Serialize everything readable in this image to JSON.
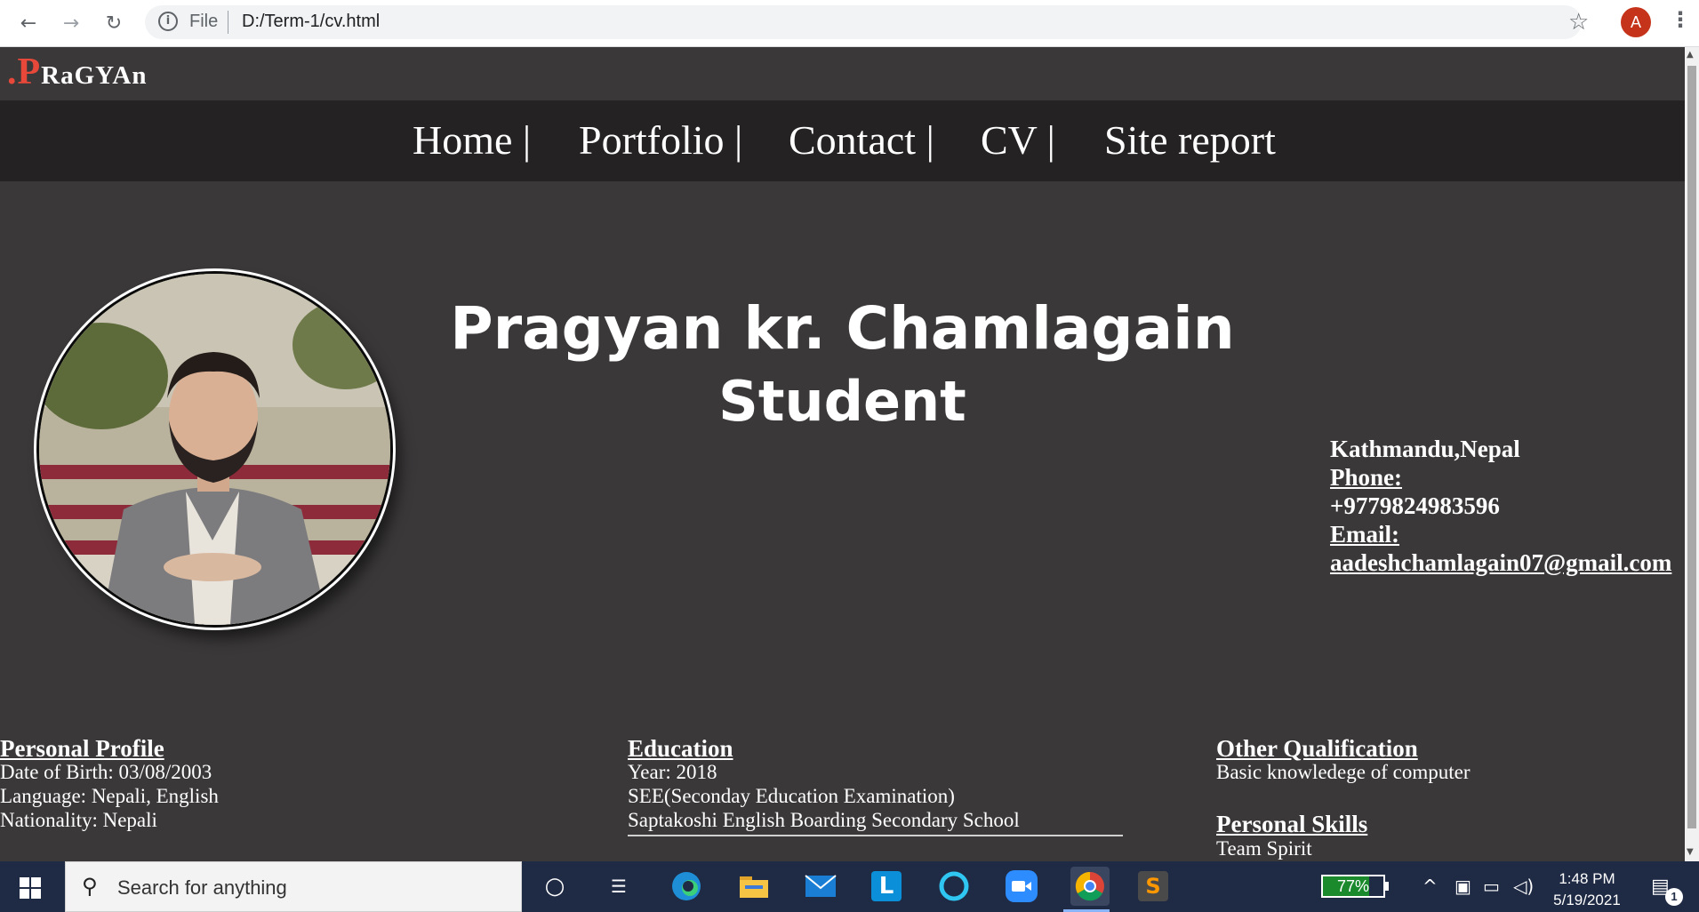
{
  "browser": {
    "url_scheme_label": "File",
    "url": "D:/Term-1/cv.html",
    "profile_initial": "A"
  },
  "site": {
    "logo": {
      "dot": ".",
      "cap": "P",
      "rest": "RaGYAn"
    },
    "nav": [
      "Home |",
      "Portfolio |",
      "Contact |",
      "CV |",
      "Site report"
    ]
  },
  "profile": {
    "name": "Pragyan kr. Chamlagain",
    "role": "Student"
  },
  "contact": {
    "address": "Kathmandu,Nepal",
    "phone_label": "Phone:",
    "phone": "+9779824983596",
    "email_label": "Email:",
    "email": "aadeshchamlagain07@gmail.com"
  },
  "sections": {
    "personal_profile": {
      "title": "Personal Profile",
      "lines": [
        "Date of Birth: 03/08/2003",
        "Language: Nepali, English",
        "Nationality: Nepali"
      ]
    },
    "education": {
      "title": "Education",
      "lines": [
        "Year: 2018",
        "SEE(Seconday Education Examination)",
        "Saptakoshi English Boarding Secondary School"
      ]
    },
    "other_qualification": {
      "title": "Other Qualification",
      "lines": [
        "Basic knowledege of computer"
      ]
    },
    "personal_skills": {
      "title": "Personal Skills",
      "lines": [
        "Team Spirit"
      ]
    }
  },
  "taskbar": {
    "search_placeholder": "Search for anything",
    "battery_percent": "77%",
    "battery_level": 0.77,
    "time": "1:48 PM",
    "date": "5/19/2021",
    "notification_count": "1"
  }
}
